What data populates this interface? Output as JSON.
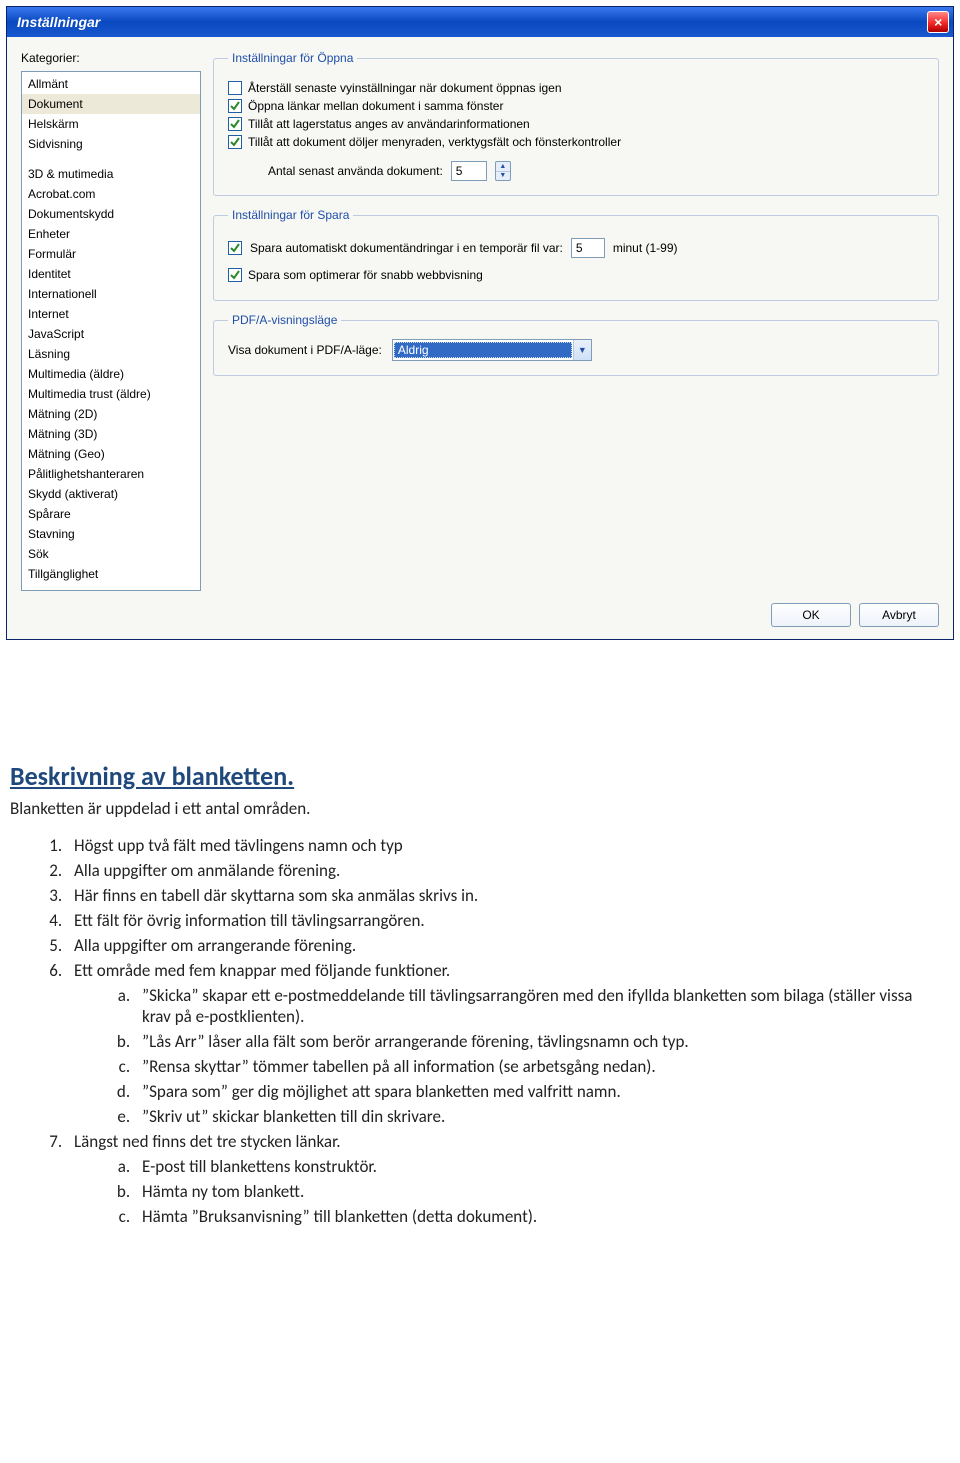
{
  "window": {
    "title": "Inställningar",
    "close_icon": "×"
  },
  "sidebar": {
    "label": "Kategorier:",
    "group1": [
      "Allmänt",
      "Dokument",
      "Helskärm",
      "Sidvisning"
    ],
    "selected": "Dokument",
    "group2": [
      "3D & mutimedia",
      "Acrobat.com",
      "Dokumentskydd",
      "Enheter",
      "Formulär",
      "Identitet",
      "Internationell",
      "Internet",
      "JavaScript",
      "Läsning",
      "Multimedia (äldre)",
      "Multimedia trust (äldre)",
      "Mätning (2D)",
      "Mätning (3D)",
      "Mätning (Geo)",
      "Pålitlighetshanteraren",
      "Skydd (aktiverat)",
      "Spårare",
      "Stavning",
      "Sök",
      "Tillgänglighet"
    ]
  },
  "open_group": {
    "legend": "Inställningar för Öppna",
    "chk_restore": {
      "label": "Återställ senaste vyinställningar när dokument öppnas igen",
      "checked": false
    },
    "chk_links": {
      "label": "Öppna länkar mellan dokument i samma fönster",
      "checked": true
    },
    "chk_layer": {
      "label": "Tillåt att lagerstatus anges av användarinformationen",
      "checked": true
    },
    "chk_hide": {
      "label": "Tillåt att dokument döljer menyraden, verktygsfält och fönsterkontroller",
      "checked": true
    },
    "recent_label": "Antal senast använda dokument:",
    "recent_value": "5"
  },
  "save_group": {
    "legend": "Inställningar för Spara",
    "chk_autosave": {
      "label": "Spara automatiskt dokumentändringar i en temporär fil var:",
      "checked": true
    },
    "autosave_value": "5",
    "autosave_unit": "minut (1-99)",
    "chk_fastweb": {
      "label": "Spara som optimerar för snabb webbvisning",
      "checked": true
    }
  },
  "pdfa_group": {
    "legend": "PDF/A-visningsläge",
    "label": "Visa dokument i PDF/A-läge:",
    "value": "Aldrig"
  },
  "buttons": {
    "ok": "OK",
    "cancel": "Avbryt"
  },
  "doc": {
    "heading": "Beskrivning av blanketten.",
    "intro": "Blanketten är uppdelad i ett antal områden.",
    "items": [
      "Högst upp två fält med tävlingens namn och typ",
      "Alla uppgifter om anmälande förening.",
      "Här finns en tabell där skyttarna som ska anmälas skrivs in.",
      "Ett fält för övrig information till tävlingsarrangören.",
      "Alla uppgifter om arrangerande förening.",
      "Ett område med fem knappar med följande funktioner."
    ],
    "subitems6": [
      "”Skicka” skapar ett e-postmeddelande till tävlingsarrangören med den ifyllda blanketten som bilaga (ställer vissa krav på e-postklienten).",
      "”Lås Arr” låser alla fält som berör arrangerande förening, tävlingsnamn och typ.",
      "”Rensa skyttar” tömmer tabellen på all information (se arbetsgång nedan).",
      "”Spara som” ger dig möjlighet att spara blanketten med valfritt namn.",
      "”Skriv ut” skickar blanketten till din skrivare."
    ],
    "item7": "Längst ned finns det tre stycken länkar.",
    "subitems7": [
      "E-post till blankettens konstruktör.",
      "Hämta ny tom blankett.",
      "Hämta ”Bruksanvisning” till blanketten (detta dokument)."
    ]
  }
}
